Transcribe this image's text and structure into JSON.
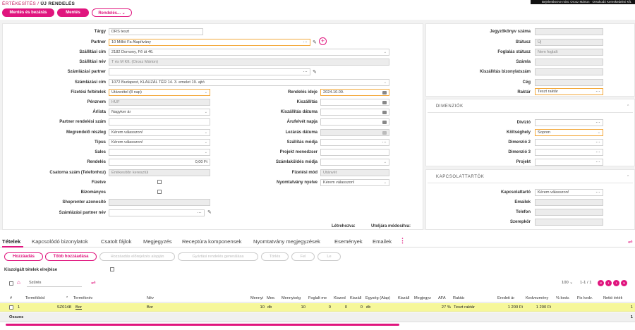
{
  "breadcrumb": {
    "root": "ÉRTÉKESÍTÉS",
    "sep": " / ",
    "current": "ÚJ RENDELÉS"
  },
  "topright": "Bejelentkezve mint: Orosz Márton · Orsskodó Kereskedelmi Kft.",
  "buttons": {
    "save_close": "Mentés és bezárás",
    "save": "Mentés",
    "order": "Rendelés... ⌄"
  },
  "left": {
    "targy_l": "Tárgy",
    "targy": "DRS teszt",
    "partner_l": "Partner",
    "partner": "10 Millió Fa Alapítvány",
    "szall_cim_l": "Szállítási cím",
    "szall_cim": "2182 Domony, Fő út 46.",
    "szall_nev_l": "Szállítási név",
    "szall_nev": "T és M Kft. (Orosz Márton)",
    "szamla_partner_l": "Számlázási partner",
    "szamla_cim_l": "Számlázási cím",
    "szamla_cim": "1072 Budapest, KLAUZÁL TÉR 14. 3. emelet 19. ajtó",
    "fizfelt_l": "Fizetési feltételek",
    "fizfelt": "Utánvétel (8 nap)",
    "penznem_l": "Pénznem",
    "penznem": "HUF",
    "arlista_l": "Árlista",
    "arlista": "Nagyker ár",
    "partner_rendszam_l": "Partner rendelési szám",
    "megrend_l": "Megrendelő részleg",
    "megrend": "Kérem válasszon!",
    "tipus_l": "Típus",
    "tipus": "Kérem válasszon!",
    "sales_l": "Sales",
    "rendeles_l": "Rendelés",
    "rendeles": "0,00 Ft",
    "csatorna_l": "Csatorna szám (Telefonhoz)",
    "csatorna": "Értékesítőn keresztül",
    "fizetve_l": "Fizetve",
    "bizonyos_l": "Bizományos",
    "shoprenter_l": "Shoprenter azonosító",
    "szamla_partnernev_l": "Számlázási partner név"
  },
  "mid": {
    "rend_ideje_l": "Rendelés ideje",
    "rend_ideje": "2024.10.09.",
    "kiszall_l": "Kiszállítás",
    "kiszall_datum_l": "Kiszállítás dátuma",
    "arufelvet_l": "Árufelvét napja",
    "lezaras_l": "Lezárás dátuma",
    "szall_mod_l": "Szállítás módja",
    "projekt_men_l": "Projekt menedzser",
    "szamlakuld_l": "Számlaküldés módja",
    "fiz_mod_l": "Fizetési mód",
    "fiz_mod": "Utánvét",
    "nyomtatvany_l": "Nyomtatvány nyelve",
    "nyomtatvany": "Kérem válasszon!",
    "letrehozva": "Létrehozva:",
    "utoljara": "Utoljára módosítva:"
  },
  "right": {
    "jegyzokonyv_l": "Jegyzőkönyv száma",
    "statusz_l": "Státusz",
    "statusz": "Új",
    "foglalas_l": "Foglalás státusz",
    "foglalas": "Nem foglalt",
    "szamla_l": "Számla",
    "kiszall_biz_l": "Kiszállítás bizonylatszám",
    "ceg_l": "Cég",
    "raktar_l": "Raktár",
    "raktar": "Teszt raktár",
    "dimenziok": "DIMENZIÓK",
    "divizio_l": "Divízió",
    "koltseghely_l": "Költséghely",
    "koltseghely": "Sopron",
    "dim2_l": "Dimenzió 2",
    "dim3_l": "Dimenzió 3",
    "projekt_l": "Projekt",
    "kapcsolattartok": "KAPCSOLATTARTÓK",
    "kapcs_l": "Kapcsolattartó",
    "kapcs": "Kérem válasszon!",
    "email_l": "Emailek",
    "telefon_l": "Telefon",
    "szerepkor_l": "Szerepkör"
  },
  "tabs": [
    "Tételek",
    "Kapcsolódó bizonylatok",
    "Csatolt fájlok",
    "Megjegyzés",
    "Receptúra komponensek",
    "Nyomtatvány megjegyzések",
    "Események",
    "Emailek"
  ],
  "actions": {
    "add": "Hozzáadás",
    "multi_add": "Több hozzáadása",
    "from_offer": "Hozzáadás előrejelzés alapján",
    "from_order": "Gyártási rendelés generálása",
    "delete": "Törlés",
    "up": "Fel",
    "down": "Le"
  },
  "filter": {
    "hide": "Kiszolgált tételek elrejtése",
    "search": "Szűrés",
    "page_size": "100 ⌄",
    "page_info": "1-1 / 1"
  },
  "table": {
    "headers": [
      "#",
      "Termékkód",
      "Terméknév",
      "Név",
      "Mennyi",
      "Mee.",
      "Mennyiség",
      "Foglalt me",
      "Kiszed",
      "Kiszáll",
      "Egység (Alap)",
      "Kiszáll",
      "Megjegyz",
      "ÁFA",
      "Raktár",
      "Eredeti ár",
      "Kedvezmény",
      "% kedv.",
      "Fix kedv.",
      "Nettó érték"
    ],
    "row": [
      "1",
      "SZ0148",
      "Bor",
      "Bor",
      "10",
      "db",
      "10",
      "0",
      "0",
      "0",
      "db",
      "",
      "",
      "27 %",
      "Teszt raktár",
      "1 200 Ft",
      "1 200 Ft",
      "",
      "",
      "1"
    ],
    "total_l": "Összes",
    "total_v": "1"
  }
}
